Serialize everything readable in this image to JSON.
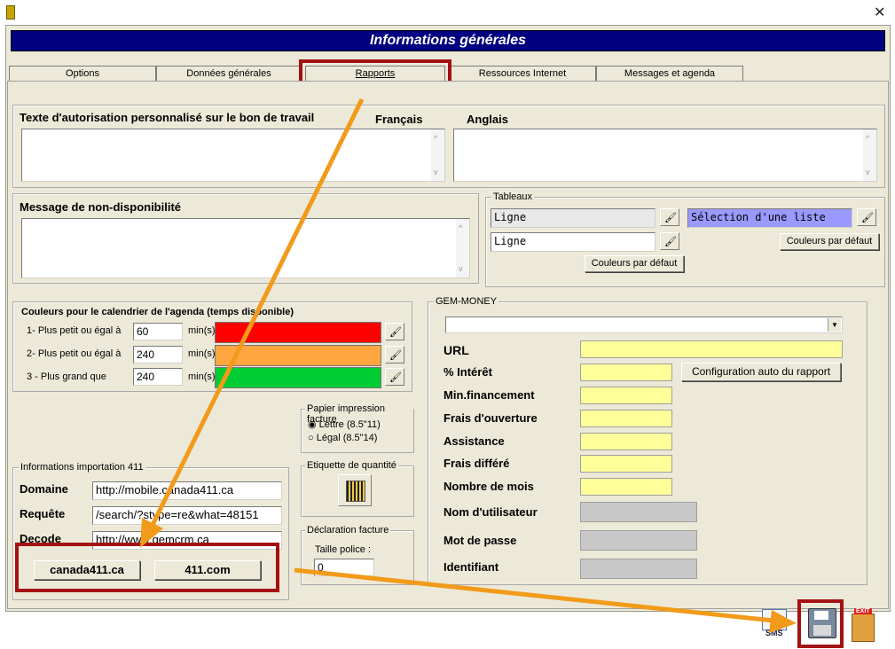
{
  "window": {
    "app_icon": "app-icon",
    "close": "✕"
  },
  "header": {
    "title": "Informations générales"
  },
  "tabs": [
    {
      "label": "Options"
    },
    {
      "label": "Données générales"
    },
    {
      "label": "Rapports"
    },
    {
      "label": "Ressources Internet"
    },
    {
      "label": "Messages et agenda"
    }
  ],
  "auth": {
    "title": "Texte d'autorisation personnalisé sur le bon de travail",
    "fr": "Français",
    "en": "Anglais"
  },
  "unavail": {
    "title": "Message de non-disponibilité"
  },
  "tableaux": {
    "title": "Tableaux",
    "field1": "Ligne",
    "field2": "Ligne",
    "selection": "Sélection d'une liste",
    "default1": "Couleurs par défaut",
    "default2": "Couleurs par défaut"
  },
  "agenda": {
    "title": "Couleurs pour le calendrier de l'agenda (temps disponible)",
    "unit": "min(s)",
    "rows": [
      {
        "label": "1- Plus petit ou égal à",
        "value": "60",
        "color": "#ff0000"
      },
      {
        "label": "2- Plus petit ou égal à",
        "value": "240",
        "color": "#ffa640"
      },
      {
        "label": "3 - Plus grand que",
        "value": "240",
        "color": "#00cc33"
      }
    ]
  },
  "paper": {
    "title": "Papier impression facture",
    "opt1": "Lettre (8.5\"11)",
    "opt2": "Légal (8.5\"14)"
  },
  "etiquette": {
    "title": "Etiquette de quantité"
  },
  "declaration": {
    "title": "Déclaration facture",
    "taille_label": "Taille police :",
    "taille_value": "0"
  },
  "import411": {
    "title": "Informations importation 411",
    "domaine_label": "Domaine",
    "domaine": "http://mobile.canada411.ca",
    "requete_label": "Requête",
    "requete": "/search/?stype=re&what=48151",
    "decode_label": "Decode",
    "decode": "http://www.gemcrm.ca",
    "btn1": "canada411.ca",
    "btn2": "411.com"
  },
  "gem": {
    "title": "GEM-MONEY",
    "url": "URL",
    "interet": "% Intérêt",
    "config": "Configuration auto du rapport",
    "minfin": "Min.financement",
    "frais_ouv": "Frais d'ouverture",
    "assistance": "Assistance",
    "frais_diff": "Frais différé",
    "nb_mois": "Nombre de mois",
    "user": "Nom d'utilisateur",
    "pass": "Mot de passe",
    "ident": "Identifiant"
  },
  "footer": {
    "sms": "SMS",
    "exit": "EXIT"
  },
  "colors": {
    "arrow": "#f29a1a",
    "highlight": "#a31212",
    "title_bg": "#000080",
    "yellow": "#ffff99"
  }
}
